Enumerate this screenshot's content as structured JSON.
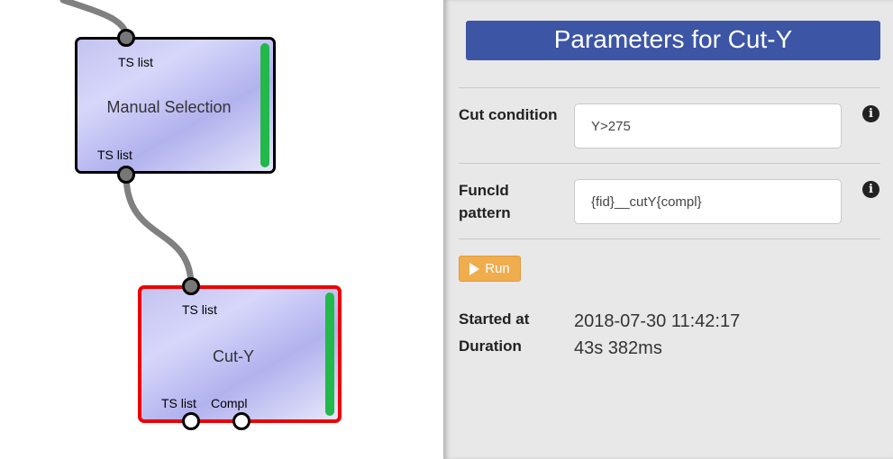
{
  "canvas": {
    "nodes": [
      {
        "title": "Manual Selection",
        "input_port_label": "TS list",
        "output_port_label": "TS list",
        "status_color": "#22b84a",
        "selected": false
      },
      {
        "title": "Cut-Y",
        "input_port_label": "TS list",
        "output_port_labels": [
          "TS list",
          "Compl"
        ],
        "status_color": "#22b84a",
        "border_color": "#ee0000",
        "selected": true
      }
    ],
    "link_color": "#808080"
  },
  "panel": {
    "header": "Parameters for Cut-Y",
    "header_color": "#3c55a5",
    "params": [
      {
        "label": "Cut condition",
        "value": "Y>275",
        "icon": "info-icon"
      },
      {
        "label": "FuncId pattern",
        "value": "{fid}__cutY{compl}",
        "icon": "info-icon"
      }
    ],
    "run_label": "Run",
    "run_color": "#f0ad4e",
    "started_label": "Started at",
    "started_value": "2018-07-30 11:42:17",
    "duration_label": "Duration",
    "duration_value": "43s 382ms"
  }
}
